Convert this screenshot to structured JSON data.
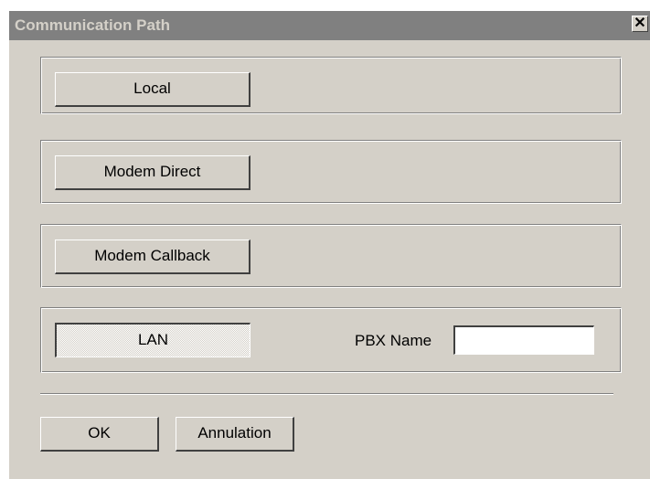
{
  "window": {
    "title": "Communication Path",
    "close_symbol": "✕",
    "close_icon": "close-icon"
  },
  "paths": {
    "local_label": "Local",
    "modem_direct_label": "Modem Direct",
    "modem_callback_label": "Modem Callback",
    "lan_label": "LAN",
    "selected": "LAN"
  },
  "pbx": {
    "label": "PBX Name",
    "value": ""
  },
  "footer": {
    "ok_label": "OK",
    "annulation_label": "Annulation"
  },
  "colors": {
    "face": "#d4d0c8",
    "titlebar": "#808080",
    "title_text": "#d4d0c8"
  }
}
